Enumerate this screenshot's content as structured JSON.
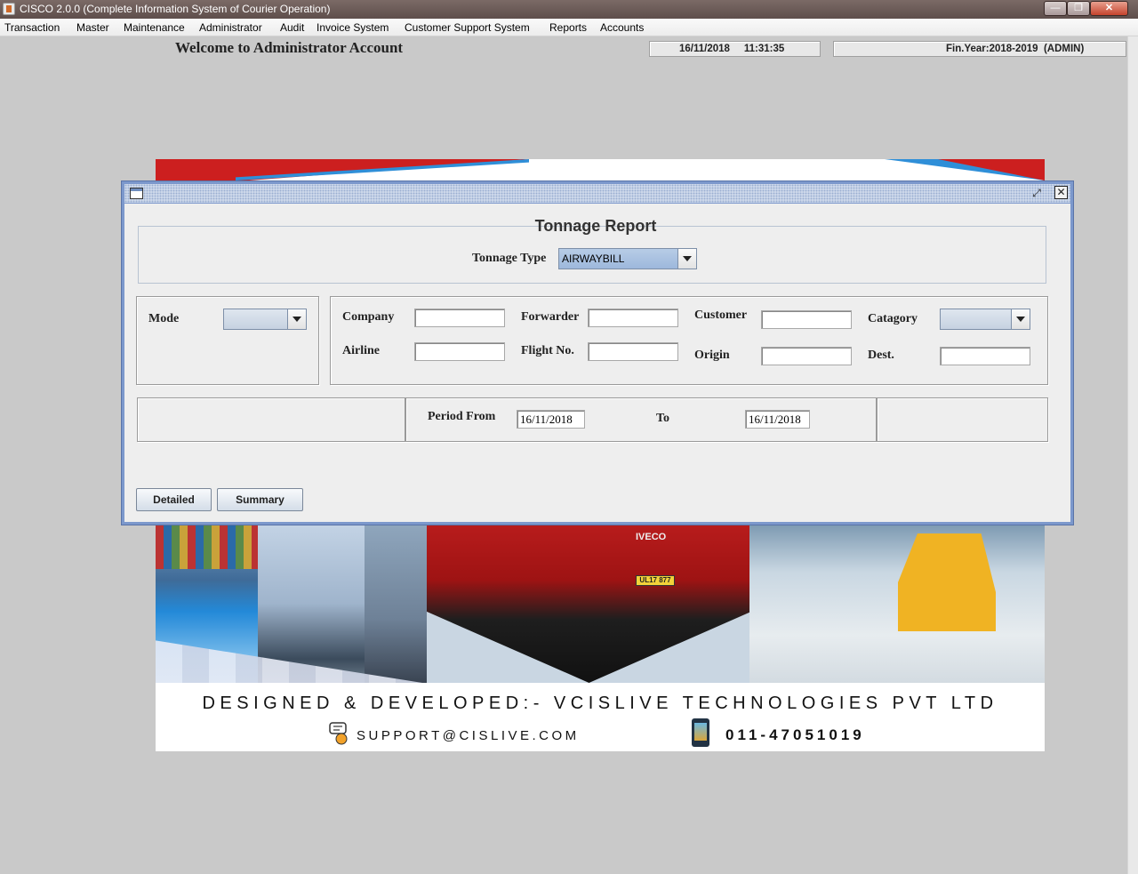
{
  "window": {
    "title": "CISCO 2.0.0 (Complete Information System of Courier Operation)",
    "minimize_label": "—",
    "maximize_label": "❐",
    "close_label": "✕"
  },
  "menu": [
    {
      "label": "Transaction"
    },
    {
      "label": "Master"
    },
    {
      "label": "Maintenance"
    },
    {
      "label": "Administrator"
    },
    {
      "label": "Audit"
    },
    {
      "label": "Invoice System"
    },
    {
      "label": "Customer Support System"
    },
    {
      "label": "Reports"
    },
    {
      "label": "Accounts"
    }
  ],
  "header": {
    "welcome": "Welcome to Administrator Account",
    "datetime": "16/11/2018     11:31:35",
    "fin_year": "Fin.Year:2018-2019  (ADMIN)"
  },
  "banner": {
    "designed_by": "DESIGNED & DEVELOPED:- VCISLIVE TECHNOLOGIES PVT LTD",
    "support_email": "SUPPORT@CISLIVE.COM",
    "phone": "011-47051019",
    "truck_brand": "IVECO",
    "truck_plate": "UL17 877"
  },
  "dialog": {
    "restore_label": "⤢",
    "close_label": "✕",
    "title": "Tonnage Report",
    "tonnage_type": {
      "label": "Tonnage Type",
      "value": "AIRWAYBILL"
    },
    "mode": {
      "label": "Mode",
      "value": ""
    },
    "company": {
      "label": "Company",
      "value": ""
    },
    "forwarder": {
      "label": "Forwarder",
      "value": ""
    },
    "customer": {
      "label": "Customer",
      "value": ""
    },
    "catagory": {
      "label": "Catagory",
      "value": ""
    },
    "airline": {
      "label": "Airline",
      "value": ""
    },
    "flight_no": {
      "label": "Flight No.",
      "value": ""
    },
    "origin": {
      "label": "Origin",
      "value": ""
    },
    "dest": {
      "label": "Dest.",
      "value": ""
    },
    "period_from": {
      "label": "Period From",
      "value": "16/11/2018"
    },
    "period_to": {
      "label": "To",
      "value": "16/11/2018"
    },
    "buttons": {
      "detailed": "Detailed",
      "summary": "Summary"
    }
  }
}
